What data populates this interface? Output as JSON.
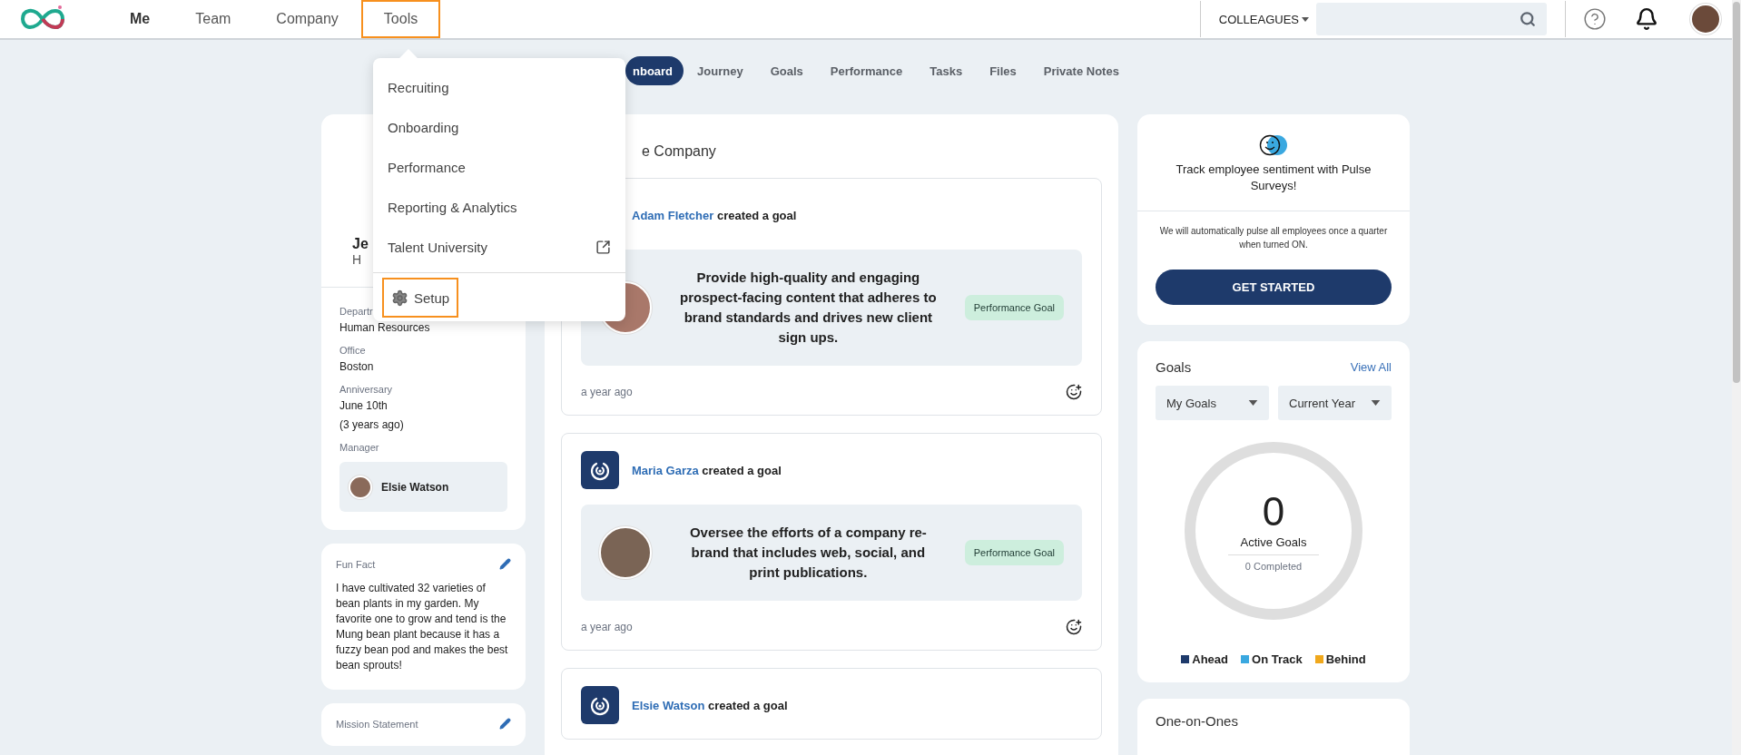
{
  "nav": {
    "items": [
      {
        "label": "Me",
        "selected": true,
        "highlighted": false
      },
      {
        "label": "Team",
        "selected": false,
        "highlighted": false
      },
      {
        "label": "Company",
        "selected": false,
        "highlighted": false
      },
      {
        "label": "Tools",
        "selected": false,
        "highlighted": true
      }
    ]
  },
  "search": {
    "scope": "COLLEAGUES"
  },
  "tools_menu": {
    "items": [
      {
        "label": "Recruiting",
        "external": false
      },
      {
        "label": "Onboarding",
        "external": false
      },
      {
        "label": "Performance",
        "external": false
      },
      {
        "label": "Reporting & Analytics",
        "external": false
      },
      {
        "label": "Talent University",
        "external": true
      }
    ],
    "footer": {
      "label": "Setup",
      "highlighted": true
    }
  },
  "tabs": [
    {
      "label": "nboard",
      "selected": true
    },
    {
      "label": "Journey",
      "selected": false
    },
    {
      "label": "Goals",
      "selected": false
    },
    {
      "label": "Performance",
      "selected": false
    },
    {
      "label": "Tasks",
      "selected": false
    },
    {
      "label": "Files",
      "selected": false
    },
    {
      "label": "Private Notes",
      "selected": false
    }
  ],
  "profile": {
    "name": "Je",
    "subtitle": "H",
    "fields": [
      {
        "label": "Departr",
        "lines": [
          "Human Resources"
        ]
      },
      {
        "label": "Office",
        "lines": [
          "Boston"
        ]
      },
      {
        "label": "Anniversary",
        "lines": [
          "June 10th",
          "(3 years ago)"
        ]
      }
    ],
    "manager": {
      "label": "Manager",
      "name": "Elsie Watson"
    }
  },
  "fun_fact": {
    "title": "Fun Fact",
    "text": "I have cultivated 32 varieties of bean plants in my garden. My favorite one to grow and tend is the Mung bean plant because it has a fuzzy bean pod and makes the best bean sprouts!"
  },
  "mission": {
    "title": "Mission Statement"
  },
  "feed": {
    "title": "e Company",
    "items": [
      {
        "author": "Adam Fletcher",
        "action": "created a goal",
        "goal": "Provide high-quality and engaging prospect-facing content that adheres to brand standards and drives new client sign ups.",
        "tag": "Performance Goal",
        "time": "a year ago"
      },
      {
        "author": "Maria Garza",
        "action": "created a goal",
        "goal": "Oversee the efforts of a company re-brand that includes web, social, and print publications.",
        "tag": "Performance Goal",
        "time": "a year ago"
      },
      {
        "author": "Elsie Watson",
        "action": "created a goal"
      }
    ]
  },
  "pulse": {
    "title": "Track employee sentiment with Pulse Surveys!",
    "note": "We will automatically pulse all employees once a quarter when turned ON.",
    "button": "GET STARTED"
  },
  "goals": {
    "title": "Goals",
    "link": "View All",
    "filters": [
      "My Goals",
      "Current Year"
    ],
    "count": "0",
    "count_label": "Active Goals",
    "completed": "0 Completed",
    "legend": [
      {
        "label": "Ahead",
        "color": "#1e3a6b"
      },
      {
        "label": "On Track",
        "color": "#3aa8e0"
      },
      {
        "label": "Behind",
        "color": "#f0a81c"
      }
    ]
  },
  "one_on_ones": {
    "title": "One-on-Ones"
  }
}
